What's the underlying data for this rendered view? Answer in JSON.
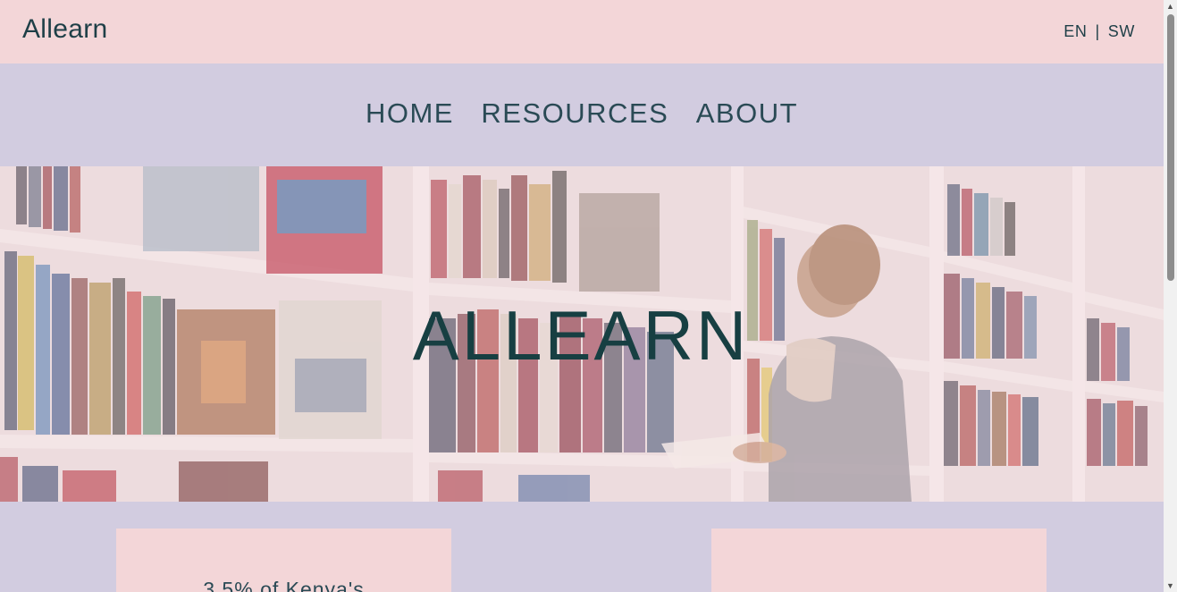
{
  "header": {
    "brand": "Allearn",
    "lang_en": "EN",
    "lang_sep": "|",
    "lang_sw": "SW"
  },
  "nav": {
    "items": [
      {
        "label": "HOME"
      },
      {
        "label": "RESOURCES"
      },
      {
        "label": "ABOUT"
      }
    ]
  },
  "hero": {
    "title": "ALLEARN"
  },
  "cards": [
    {
      "text": "3.5% of Kenya's"
    },
    {
      "text": ""
    }
  ],
  "colors": {
    "topbar": "#f3d6d8",
    "background": "#d2cce0",
    "text": "#1e3f47",
    "hero_title": "#173f42"
  }
}
